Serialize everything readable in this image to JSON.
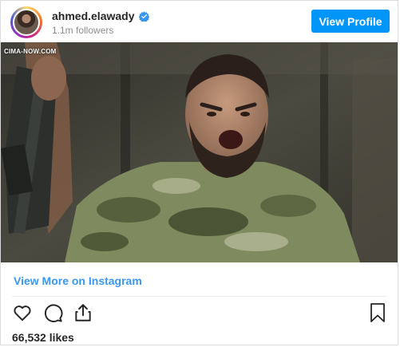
{
  "header": {
    "username": "ahmed.elawady",
    "followers": "1.1m followers",
    "view_profile_label": "View Profile"
  },
  "media": {
    "watermark": "CIMA-NOW.COM"
  },
  "footer": {
    "view_more_label": "View More on Instagram",
    "likes": "66,532 likes"
  },
  "icons": {
    "verified": "verified-badge-icon",
    "like": "heart-icon",
    "comment": "comment-icon",
    "share": "share-icon",
    "save": "bookmark-icon"
  },
  "colors": {
    "accent": "#0095f6",
    "link": "#3897f0",
    "text": "#262626",
    "muted": "#8e8e8e"
  }
}
